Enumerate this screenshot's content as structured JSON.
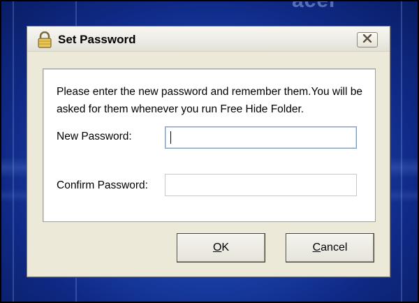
{
  "desktop": {
    "logo_text": "acer"
  },
  "dialog": {
    "title": "Set Password",
    "icons": {
      "title_icon": "lock-icon",
      "close_icon": "close-icon"
    },
    "instructions": "Please enter the new password and remember them.You will be asked for them whenever you run Free Hide Folder.",
    "fields": {
      "new_password": {
        "label": "New Password:",
        "value": ""
      },
      "confirm_password": {
        "label": "Confirm Password:",
        "value": ""
      }
    },
    "buttons": {
      "ok": {
        "mnemonic": "O",
        "rest": "K"
      },
      "cancel": {
        "mnemonic": "C",
        "rest": "ancel"
      }
    }
  },
  "colors": {
    "dialog_bg": "#ece9d8",
    "desktop_blue": "#1f47b3",
    "panel_bg": "#ffffff",
    "focus_border": "#7f9db9"
  }
}
